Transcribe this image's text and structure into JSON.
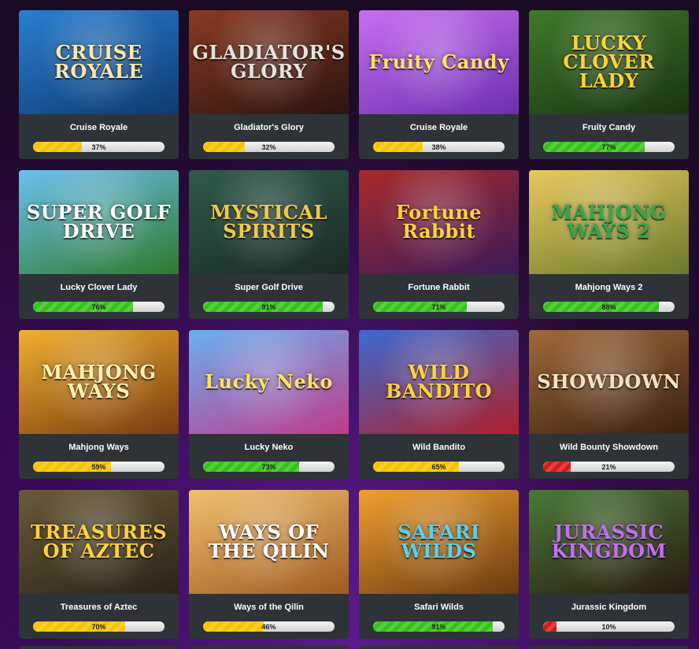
{
  "games": [
    {
      "name": "Cruise Royale",
      "art": "CRUISE ROYALE",
      "percent": "37%",
      "value": 37,
      "bar_color": "yellow",
      "bg": [
        "#2a7fd0",
        "#0e3a70"
      ],
      "art_color": "#ffe7a8"
    },
    {
      "name": "Gladiator's Glory",
      "art": "GLADIATOR'S GLORY",
      "percent": "32%",
      "value": 32,
      "bar_color": "yellow",
      "bg": [
        "#8a3a22",
        "#2a1410"
      ],
      "art_color": "#e6e2dc"
    },
    {
      "name": "Cruise Royale",
      "art": "Fruity Candy",
      "percent": "38%",
      "value": 38,
      "bar_color": "yellow",
      "bg": [
        "#c86ff0",
        "#6c2fb0"
      ],
      "art_color": "#ffe25a"
    },
    {
      "name": "Fruity Candy",
      "art": "LUCKY CLOVER LADY",
      "percent": "77%",
      "value": 77,
      "bar_color": "green",
      "bg": [
        "#3f7a2a",
        "#1b3312"
      ],
      "art_color": "#ffd23a"
    },
    {
      "name": "Lucky Clover Lady",
      "art": "SUPER GOLF DRIVE",
      "percent": "76%",
      "value": 76,
      "bar_color": "green",
      "bg": [
        "#6cc0f0",
        "#2f7a2a"
      ],
      "art_color": "#ffffff"
    },
    {
      "name": "Super Golf Drive",
      "art": "MYSTICAL SPIRITS",
      "percent": "91%",
      "value": 91,
      "bar_color": "green",
      "bg": [
        "#2f5a4a",
        "#1a2a24"
      ],
      "art_color": "#f3c84a"
    },
    {
      "name": "Fortune Rabbit",
      "art": "Fortune Rabbit",
      "percent": "71%",
      "value": 71,
      "bar_color": "green",
      "bg": [
        "#a82a2a",
        "#3a1a5a"
      ],
      "art_color": "#ffd23a"
    },
    {
      "name": "Mahjong Ways 2",
      "art": "MAHJONG WAYS 2",
      "percent": "88%",
      "value": 88,
      "bar_color": "green",
      "bg": [
        "#e8c860",
        "#6a7a2a"
      ],
      "art_color": "#2fa84a"
    },
    {
      "name": "Mahjong Ways",
      "art": "MAHJONG WAYS",
      "percent": "59%",
      "value": 59,
      "bar_color": "yellow",
      "bg": [
        "#f0b030",
        "#7a3a10"
      ],
      "art_color": "#fff3b0"
    },
    {
      "name": "Lucky Neko",
      "art": "Lucky Neko",
      "percent": "73%",
      "value": 73,
      "bar_color": "green",
      "bg": [
        "#6ab0f0",
        "#c03a8a"
      ],
      "art_color": "#ffe25a"
    },
    {
      "name": "Wild Bandito",
      "art": "WILD BANDITO",
      "percent": "65%",
      "value": 65,
      "bar_color": "yellow",
      "bg": [
        "#3a6ad0",
        "#b0202a"
      ],
      "art_color": "#ffd23a"
    },
    {
      "name": "Wild Bounty Showdown",
      "art": "SHOWDOWN",
      "percent": "21%",
      "value": 21,
      "bar_color": "red",
      "bg": [
        "#a06a3a",
        "#3a2010"
      ],
      "art_color": "#f3e2c0"
    },
    {
      "name": "Treasures of Aztec",
      "art": "TREASURES OF AZTEC",
      "percent": "70%",
      "value": 70,
      "bar_color": "yellow",
      "bg": [
        "#6a5a3a",
        "#2a2418"
      ],
      "art_color": "#ffd23a"
    },
    {
      "name": "Ways of the Qilin",
      "art": "WAYS OF THE QILIN",
      "percent": "46%",
      "value": 46,
      "bar_color": "yellow",
      "bg": [
        "#f0c070",
        "#a05a20"
      ],
      "art_color": "#ffffff"
    },
    {
      "name": "Safari Wilds",
      "art": "SAFARI WILDS",
      "percent": "91%",
      "value": 91,
      "bar_color": "green",
      "bg": [
        "#f0a030",
        "#6a3a10"
      ],
      "art_color": "#5ad0f0"
    },
    {
      "name": "Jurassic Kingdom",
      "art": "JURASSIC KINGDOM",
      "percent": "10%",
      "value": 10,
      "bar_color": "red",
      "bg": [
        "#4a7a3a",
        "#2a1a10"
      ],
      "art_color": "#c070f0"
    }
  ]
}
